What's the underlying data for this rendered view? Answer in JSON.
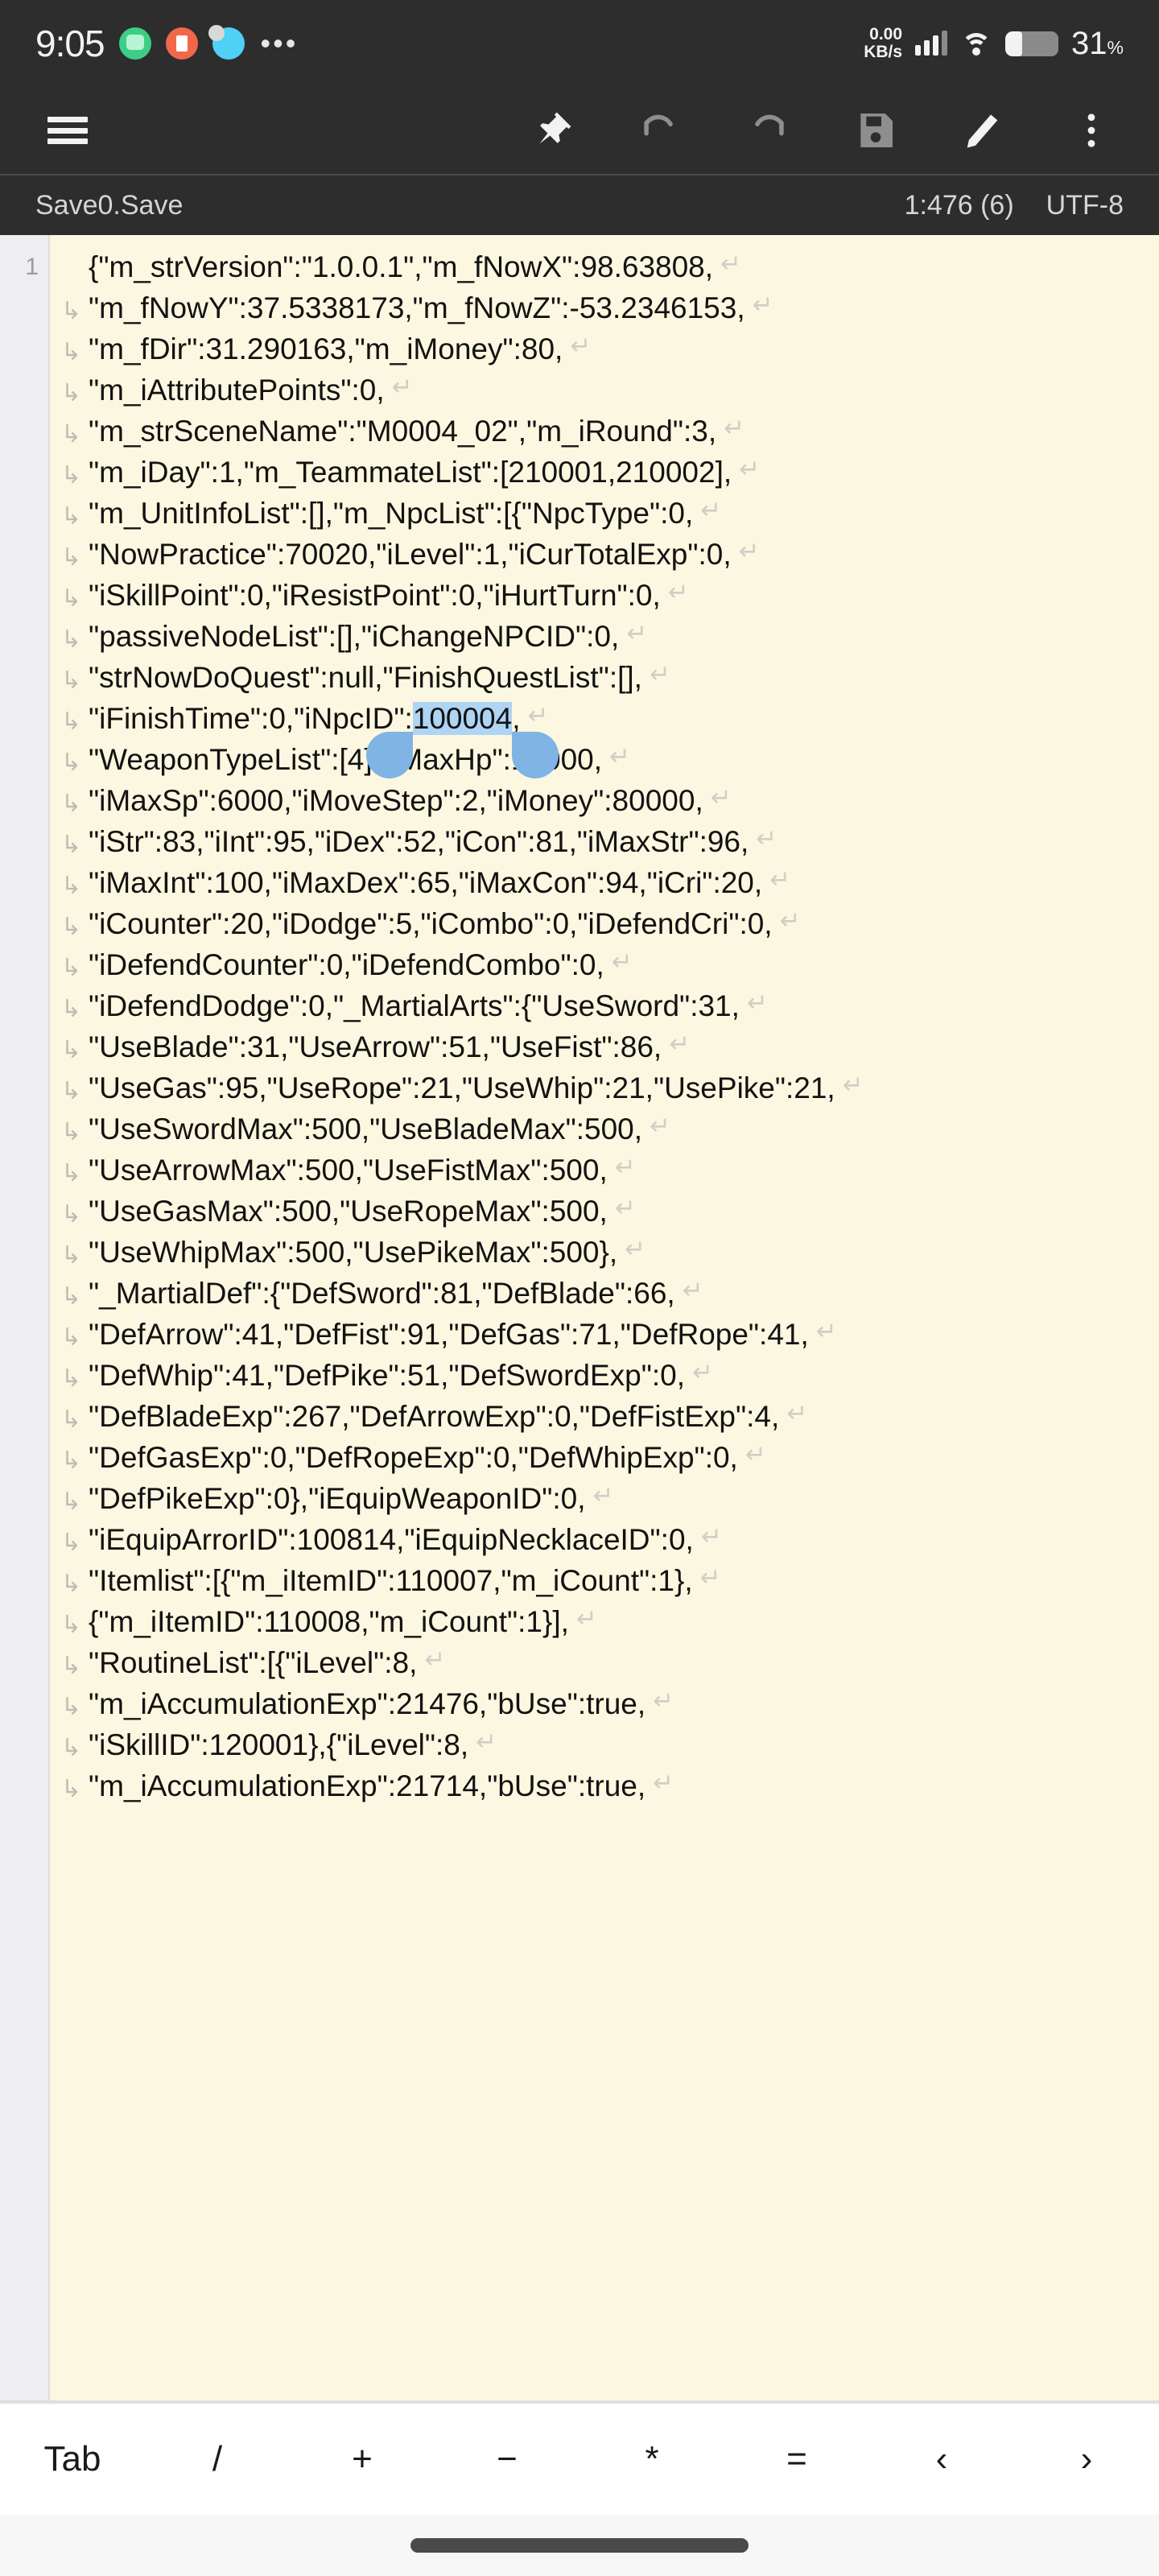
{
  "status_bar": {
    "clock": "9:05",
    "app_icons": [
      "chat-icon",
      "trash-icon",
      "weather-icon"
    ],
    "overflow": "•••",
    "net_speed_value": "0.00",
    "net_speed_unit": "KB/s",
    "signal": "signal-bars-icon",
    "wifi": "wifi-icon",
    "battery_percent": "31",
    "battery_percent_symbol": "%",
    "battery_level": 31
  },
  "toolbar": {
    "menu_label": "menu-icon",
    "pin_label": "pin-icon",
    "undo_label": "undo-icon",
    "redo_label": "redo-icon",
    "save_label": "save-icon",
    "edit_label": "edit-icon",
    "more_label": "more-vert-icon"
  },
  "file_bar": {
    "filename": "Save0.Save",
    "position": "1:476 (6)",
    "encoding": "UTF-8"
  },
  "editor": {
    "line_number": "1",
    "wrap_continuation_glyph": "↳",
    "eol_glyph": "↵",
    "selection_color": "#AFD4F4",
    "handle_color": "#7FB4E4",
    "background": "#FCF7E0",
    "gutter_background": "#EDEDF2",
    "lines": [
      {
        "first": true,
        "text": "{\"m_strVersion\":\"1.0.0.1\",\"m_fNowX\":98.63808,"
      },
      {
        "first": false,
        "text": "\"m_fNowY\":37.5338173,\"m_fNowZ\":-53.2346153,"
      },
      {
        "first": false,
        "text": "\"m_fDir\":31.290163,\"m_iMoney\":80,"
      },
      {
        "first": false,
        "text": "\"m_iAttributePoints\":0,"
      },
      {
        "first": false,
        "text": "\"m_strSceneName\":\"M0004_02\",\"m_iRound\":3,"
      },
      {
        "first": false,
        "text": "\"m_iDay\":1,\"m_TeammateList\":[210001,210002],"
      },
      {
        "first": false,
        "text": "\"m_UnitInfoList\":[],\"m_NpcList\":[{\"NpcType\":0,"
      },
      {
        "first": false,
        "text": "\"NowPractice\":70020,\"iLevel\":1,\"iCurTotalExp\":0,"
      },
      {
        "first": false,
        "text": "\"iSkillPoint\":0,\"iResistPoint\":0,\"iHurtTurn\":0,"
      },
      {
        "first": false,
        "text": "\"passiveNodeList\":[],\"iChangeNPCID\":0,"
      },
      {
        "first": false,
        "text": "\"strNowDoQuest\":null,\"FinishQuestList\":[],"
      },
      {
        "first": false,
        "pre": "\"iFinishTime\":0,\"iNpcID\":",
        "selected": "100004",
        "post": ","
      },
      {
        "first": false,
        "text": "\"WeaponTypeList\":[4],\"iMaxHp\":18000,"
      },
      {
        "first": false,
        "text": "\"iMaxSp\":6000,\"iMoveStep\":2,\"iMoney\":80000,"
      },
      {
        "first": false,
        "text": "\"iStr\":83,\"iInt\":95,\"iDex\":52,\"iCon\":81,\"iMaxStr\":96,"
      },
      {
        "first": false,
        "text": "\"iMaxInt\":100,\"iMaxDex\":65,\"iMaxCon\":94,\"iCri\":20,"
      },
      {
        "first": false,
        "text": "\"iCounter\":20,\"iDodge\":5,\"iCombo\":0,\"iDefendCri\":0,"
      },
      {
        "first": false,
        "text": "\"iDefendCounter\":0,\"iDefendCombo\":0,"
      },
      {
        "first": false,
        "text": "\"iDefendDodge\":0,\"_MartialArts\":{\"UseSword\":31,"
      },
      {
        "first": false,
        "text": "\"UseBlade\":31,\"UseArrow\":51,\"UseFist\":86,"
      },
      {
        "first": false,
        "text": "\"UseGas\":95,\"UseRope\":21,\"UseWhip\":21,\"UsePike\":21,"
      },
      {
        "first": false,
        "text": "\"UseSwordMax\":500,\"UseBladeMax\":500,"
      },
      {
        "first": false,
        "text": "\"UseArrowMax\":500,\"UseFistMax\":500,"
      },
      {
        "first": false,
        "text": "\"UseGasMax\":500,\"UseRopeMax\":500,"
      },
      {
        "first": false,
        "text": "\"UseWhipMax\":500,\"UsePikeMax\":500},"
      },
      {
        "first": false,
        "text": "\"_MartialDef\":{\"DefSword\":81,\"DefBlade\":66,"
      },
      {
        "first": false,
        "text": "\"DefArrow\":41,\"DefFist\":91,\"DefGas\":71,\"DefRope\":41,"
      },
      {
        "first": false,
        "text": "\"DefWhip\":41,\"DefPike\":51,\"DefSwordExp\":0,"
      },
      {
        "first": false,
        "text": "\"DefBladeExp\":267,\"DefArrowExp\":0,\"DefFistExp\":4,"
      },
      {
        "first": false,
        "text": "\"DefGasExp\":0,\"DefRopeExp\":0,\"DefWhipExp\":0,"
      },
      {
        "first": false,
        "text": "\"DefPikeExp\":0},\"iEquipWeaponID\":0,"
      },
      {
        "first": false,
        "text": "\"iEquipArrorID\":100814,\"iEquipNecklaceID\":0,"
      },
      {
        "first": false,
        "text": "\"Itemlist\":[{\"m_iItemID\":110007,\"m_iCount\":1},"
      },
      {
        "first": false,
        "text": "{\"m_iItemID\":110008,\"m_iCount\":1}],"
      },
      {
        "first": false,
        "text": "\"RoutineList\":[{\"iLevel\":8,"
      },
      {
        "first": false,
        "text": "\"m_iAccumulationExp\":21476,\"bUse\":true,"
      },
      {
        "first": false,
        "text": "\"iSkillID\":120001},{\"iLevel\":8,"
      },
      {
        "first": false,
        "text": "\"m_iAccumulationExp\":21714,\"bUse\":true,",
        "clipped": true
      }
    ]
  },
  "key_row": {
    "keys": [
      {
        "label": "Tab",
        "name": "key-tab"
      },
      {
        "label": "/",
        "name": "key-slash"
      },
      {
        "label": "+",
        "name": "key-plus"
      },
      {
        "label": "−",
        "name": "key-minus"
      },
      {
        "label": "*",
        "name": "key-asterisk"
      },
      {
        "label": "=",
        "name": "key-equals"
      },
      {
        "label": "‹",
        "name": "key-less-than"
      },
      {
        "label": "›",
        "name": "key-greater-than"
      }
    ]
  },
  "nav_bar": {
    "gesture_pill": "gesture-pill"
  }
}
